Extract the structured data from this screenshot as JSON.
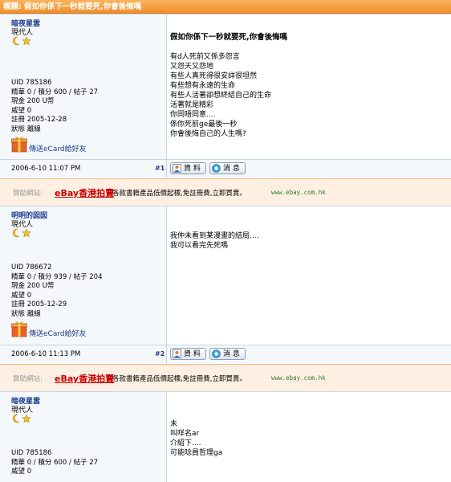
{
  "thread_title": "標題: 假如你係下一秒就要死,你會後悔嗎",
  "posts": [
    {
      "username": "暗夜星雲",
      "level": "現代人",
      "stats": [
        "UID 785186",
        "精華 0 / 積分 600 / 帖子 27",
        "現金 200 U幣",
        "威望 0",
        "註冊 2005-12-28",
        "狀態 離線"
      ],
      "ecard": "傳送eCard給好友",
      "title": "假如你係下一秒就要死,你會後悔嗎",
      "lines": [
        "有d人死前又係多怨言",
        "又怨天又怨地",
        "有些人真死得很安詳很坦然",
        "有些想有永遠的生命",
        "有些人活著卻想終結自己的生命",
        "活著就是精彩",
        "你同唔同意....",
        "係你死前ge最後一秒",
        "你會後悔自己的人生嗎?"
      ],
      "date": "2006-6-10 11:07 PM",
      "floor": "#1"
    },
    {
      "username": "明明的囡囡",
      "level": "現代人",
      "stats": [
        "UID 786672",
        "精華 0 / 積分 939 / 帖子 204",
        "現金 200 U幣",
        "威望 0",
        "註冊 2005-12-29",
        "狀態 離線"
      ],
      "ecard": "傳送eCard給好友",
      "title": "",
      "lines": [
        "我仲未看到某漫畫的結局....",
        "我可以看完先死嗎"
      ],
      "date": "2006-6-10 11:13 PM",
      "floor": "#2"
    },
    {
      "username": "暗夜星雲",
      "level": "現代人",
      "stats": [
        "UID 785186",
        "精華 0 / 積分 600 / 帖子 27",
        "威望 0"
      ],
      "ecard": "",
      "title": "",
      "lines": [
        "未",
        "叫咩名ar",
        "介紹下....",
        "可能唸員哲理ga"
      ],
      "date": "",
      "floor": ""
    }
  ],
  "buttons": {
    "profile": "資 料",
    "message": "消 息"
  },
  "ad": {
    "sponsor_label": "贊助網站:",
    "brand": "eBay香港拍賣",
    "desc": "各款書籍產品低價起標,免註冊費,立即買賣。",
    "url": "www.ebay.com.hk"
  },
  "colors": {
    "title_bar": "#f39b3a",
    "username": "#1a3d8f",
    "ad_bg": "#fdf0e3",
    "ad_brand": "#cc0000"
  }
}
